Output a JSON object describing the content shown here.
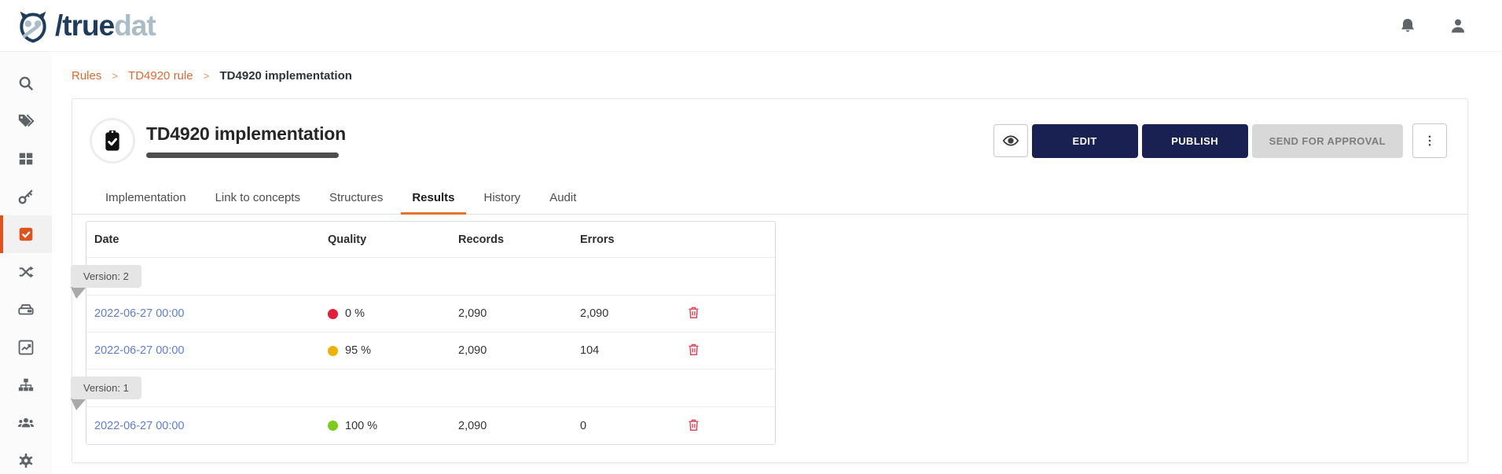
{
  "topbar": {
    "logo": {
      "part_dark": "/true",
      "part_light": "dat",
      "icon": "owl-logo-icon"
    },
    "icons": [
      "notifications-bell",
      "user-profile"
    ]
  },
  "sidebar": {
    "items": [
      {
        "name": "search"
      },
      {
        "name": "tags"
      },
      {
        "name": "dashboard-grid"
      },
      {
        "name": "access-key"
      },
      {
        "name": "quality-rules",
        "active": true
      },
      {
        "name": "relations-shuffle"
      },
      {
        "name": "data-storage"
      },
      {
        "name": "analytics-chart"
      },
      {
        "name": "lineage-hierarchy"
      },
      {
        "name": "user-groups"
      },
      {
        "name": "settings-gear"
      }
    ]
  },
  "breadcrumb": {
    "separator": ">",
    "items": [
      {
        "label": "Rules",
        "link": true
      },
      {
        "label": "TD4920 rule",
        "link": true
      },
      {
        "label": "TD4920 implementation",
        "link": false
      }
    ]
  },
  "page": {
    "title": "TD4920 implementation",
    "entity_icon": "clipboard-check"
  },
  "actions": {
    "preview_icon": "eye",
    "edit_label": "EDIT",
    "publish_label": "PUBLISH",
    "send_for_approval_label": "SEND FOR APPROVAL",
    "more_icon": "kebab-menu"
  },
  "tabs": [
    {
      "label": "Implementation"
    },
    {
      "label": "Link to concepts"
    },
    {
      "label": "Structures"
    },
    {
      "label": "Results",
      "active": true
    },
    {
      "label": "History"
    },
    {
      "label": "Audit"
    }
  ],
  "results_table": {
    "columns": [
      "Date",
      "Quality",
      "Records",
      "Errors"
    ],
    "rows": [
      {
        "type": "version",
        "label": "Version: 2"
      },
      {
        "type": "result",
        "date": "2022-06-27 00:00",
        "quality": "0 %",
        "records": "2,090",
        "errors": "2,090",
        "status_color": "#e01f3d"
      },
      {
        "type": "result",
        "date": "2022-06-27 00:00",
        "quality": "95 %",
        "records": "2,090",
        "errors": "104",
        "status_color": "#ecb203"
      },
      {
        "type": "version",
        "label": "Version: 1"
      },
      {
        "type": "result",
        "date": "2022-06-27 00:00",
        "quality": "100 %",
        "records": "2,090",
        "errors": "0",
        "status_color": "#7ecb20"
      }
    ]
  },
  "colors": {
    "brand_navy": "#192152",
    "logo_navy": "#1f3c5c",
    "logo_light": "#a9bcc7",
    "accent_orange": "#d96a33",
    "sidebar_active_orange": "#e0521d",
    "tab_underline_orange": "#e0762e",
    "link_blue": "#5e7fce",
    "status_red": "#e01f3d",
    "status_amber": "#ecb203",
    "status_green": "#7ecb20",
    "trash_red": "#dc3d51"
  }
}
